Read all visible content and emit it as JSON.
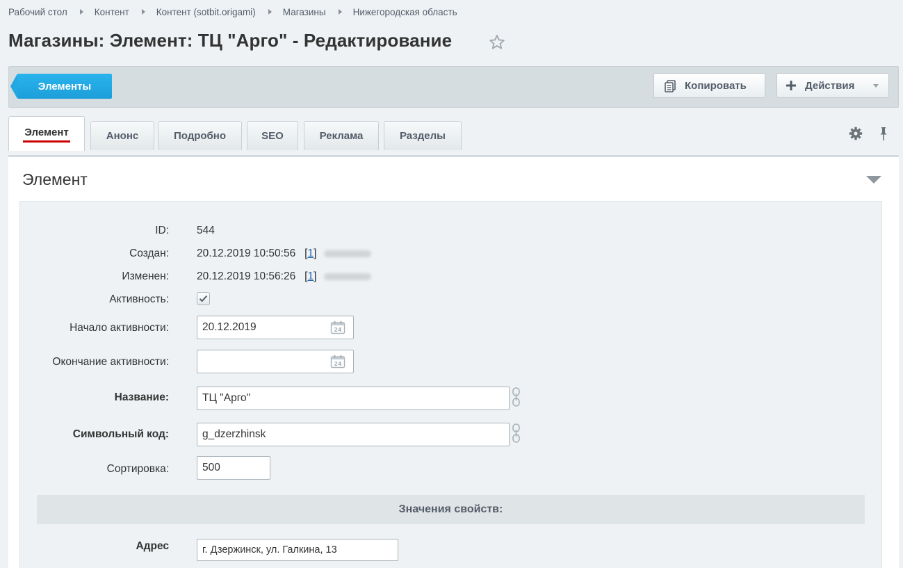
{
  "breadcrumb": [
    "Рабочий стол",
    "Контент",
    "Контент (sotbit.origami)",
    "Магазины",
    "Нижегородская область"
  ],
  "page_title": "Магазины: Элемент: ТЦ \"Арго\" - Редактирование",
  "toolbar": {
    "elements_label": "Элементы",
    "copy_label": "Копировать",
    "actions_label": "Действия"
  },
  "tabs": [
    "Элемент",
    "Анонс",
    "Подробно",
    "SEO",
    "Реклама",
    "Разделы"
  ],
  "panel": {
    "title": "Элемент"
  },
  "fields": {
    "id": {
      "label": "ID:",
      "value": "544"
    },
    "created": {
      "label": "Создан:",
      "value": "20.12.2019 10:50:56",
      "user_open": "[",
      "user_link": "1",
      "user_close": "]"
    },
    "modified": {
      "label": "Изменен:",
      "value": "20.12.2019 10:56:26",
      "user_open": "[",
      "user_link": "1",
      "user_close": "]"
    },
    "active": {
      "label": "Активность:",
      "checked": true
    },
    "active_from": {
      "label": "Начало активности:",
      "value": "20.12.2019"
    },
    "active_to": {
      "label": "Окончание активности:",
      "value": ""
    },
    "name": {
      "label": "Название:",
      "value": "ТЦ \"Арго\""
    },
    "code": {
      "label": "Символьный код:",
      "value": "g_dzerzhinsk"
    },
    "sort": {
      "label": "Сортировка:",
      "value": "500"
    },
    "props_header": "Значения свойств:",
    "address": {
      "label": "Адрес",
      "value": "г. Дзержинск, ул. Галкина, 13"
    }
  },
  "colors": {
    "accent": "#23a8e3",
    "active_tab_underline": "#cc0000",
    "link": "#2067b0"
  }
}
